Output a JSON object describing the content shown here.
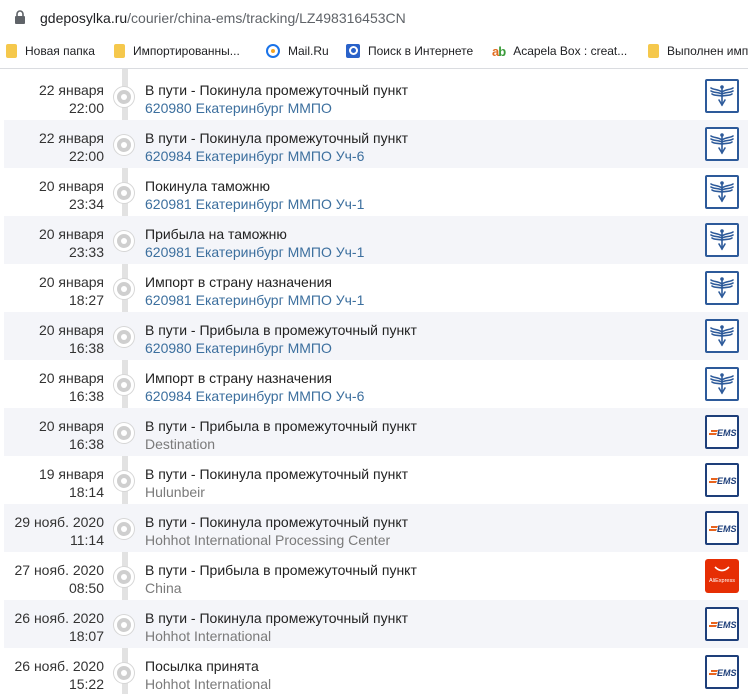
{
  "browser": {
    "url_host": "gdeposylka.ru",
    "url_path": "/courier/china-ems/tracking/LZ498316453CN",
    "bookmarks": [
      {
        "label": "Новая папка",
        "icon": "folder-icon"
      },
      {
        "label": "Импортированны...",
        "icon": "folder-icon"
      },
      {
        "label": "Mail.Ru",
        "icon": "mailru-icon"
      },
      {
        "label": "Поиск в Интернете",
        "icon": "search-icon"
      },
      {
        "label": "Acapela Box : creat...",
        "icon": "acapela-icon"
      },
      {
        "label": "Выполнен имп",
        "icon": "folder-icon"
      }
    ]
  },
  "colors": {
    "accent_link": "#3c6f9e",
    "row_shade": "#f4f5f9",
    "timeline": "#e2e2e2"
  },
  "events": [
    {
      "date": "22 января",
      "time": "22:00",
      "status": "В пути - Покинула промежуточный пункт",
      "place": "620980 Екатеринбург ММПО",
      "place_style": "blue",
      "carrier_logo": "russian-post-logo"
    },
    {
      "date": "22 января",
      "time": "22:00",
      "status": "В пути - Покинула промежуточный пункт",
      "place": "620984 Екатеринбург ММПО Уч-6",
      "place_style": "blue",
      "carrier_logo": "russian-post-logo"
    },
    {
      "date": "20 января",
      "time": "23:34",
      "status": "Покинула таможню",
      "place": "620981 Екатеринбург ММПО Уч-1",
      "place_style": "blue",
      "carrier_logo": "russian-post-logo"
    },
    {
      "date": "20 января",
      "time": "23:33",
      "status": "Прибыла на таможню",
      "place": "620981 Екатеринбург ММПО Уч-1",
      "place_style": "blue",
      "carrier_logo": "russian-post-logo"
    },
    {
      "date": "20 января",
      "time": "18:27",
      "status": "Импорт в страну назначения",
      "place": "620981 Екатеринбург ММПО Уч-1",
      "place_style": "blue",
      "carrier_logo": "russian-post-logo"
    },
    {
      "date": "20 января",
      "time": "16:38",
      "status": "В пути - Прибыла в промежуточный пункт",
      "place": "620980 Екатеринбург ММПО",
      "place_style": "blue",
      "carrier_logo": "russian-post-logo"
    },
    {
      "date": "20 января",
      "time": "16:38",
      "status": "Импорт в страну назначения",
      "place": "620984 Екатеринбург ММПО Уч-6",
      "place_style": "blue",
      "carrier_logo": "russian-post-logo"
    },
    {
      "date": "20 января",
      "time": "16:38",
      "status": "В пути - Прибыла в промежуточный пункт",
      "place": "Destination",
      "place_style": "gray",
      "carrier_logo": "ems-logo"
    },
    {
      "date": "19 января",
      "time": "18:14",
      "status": "В пути - Покинула промежуточный пункт",
      "place": "Hulunbeir",
      "place_style": "gray",
      "carrier_logo": "ems-logo"
    },
    {
      "date": "29 нояб. 2020",
      "time": "11:14",
      "status": "В пути - Покинула промежуточный пункт",
      "place": "Hohhot International Processing Center",
      "place_style": "gray",
      "carrier_logo": "ems-logo"
    },
    {
      "date": "27 нояб. 2020",
      "time": "08:50",
      "status": "В пути - Прибыла в промежуточный пункт",
      "place": "China",
      "place_style": "gray",
      "carrier_logo": "aliexpress-logo",
      "logo_text": "AliExpress"
    },
    {
      "date": "26 нояб. 2020",
      "time": "18:07",
      "status": "В пути - Покинула промежуточный пункт",
      "place": "Hohhot International",
      "place_style": "gray",
      "carrier_logo": "ems-logo"
    },
    {
      "date": "26 нояб. 2020",
      "time": "15:22",
      "status": "Посылка принята",
      "place": "Hohhot International",
      "place_style": "gray",
      "carrier_logo": "ems-logo"
    }
  ]
}
